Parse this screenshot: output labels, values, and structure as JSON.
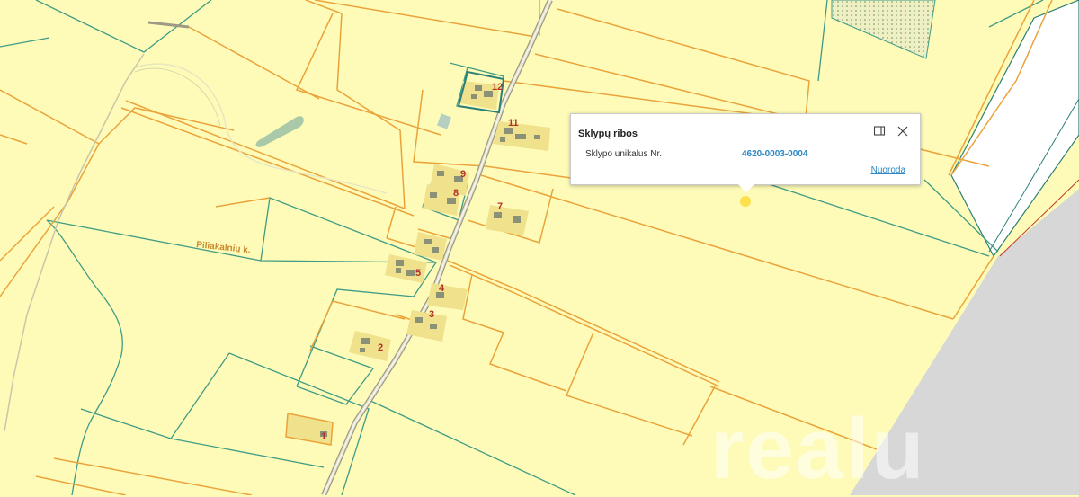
{
  "map": {
    "village_label": "Piliakalnių k.",
    "parcel_numbers": [
      "1",
      "2",
      "3",
      "4",
      "5",
      "7",
      "8",
      "9",
      "11",
      "12"
    ],
    "colors": {
      "background": "#fdfbb7",
      "parcel_line": "#eaa33b",
      "cadastre_line": "#3f9b86",
      "building_area": "#f0e18c",
      "building": "#8a9176",
      "road": "#b6b39d",
      "highlight": "#ffd93b",
      "gray_area": "#d7d7d7"
    }
  },
  "popup": {
    "title": "Sklypų ribos",
    "field_label": "Sklypo unikalus Nr.",
    "field_value": "4620-0003-0004",
    "link_label": "Nuoroda",
    "maximize_icon": "maximize-icon",
    "close_icon": "close-icon"
  },
  "watermark": {
    "text": "realu"
  }
}
